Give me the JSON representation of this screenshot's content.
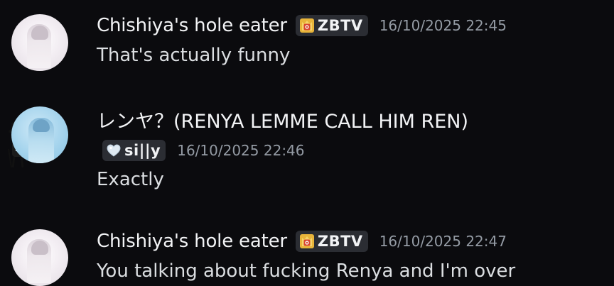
{
  "messages": [
    {
      "username": "Chishiya's hole eater",
      "tag": "ZBTV",
      "tag_icon": "crown-shield-icon",
      "timestamp": "16/10/2025 22:45",
      "content": "That's actually funny",
      "avatar": "pale-portrait"
    },
    {
      "username": "レンヤ？(RENYA LEMME CALL HIM REN)",
      "tag": "si||y",
      "tag_icon": "heart-icon",
      "timestamp": "16/10/2025 22:46",
      "content": "Exactly",
      "avatar": "blue-portrait",
      "decoration": "monopoly-man-icon"
    },
    {
      "username": "Chishiya's hole eater",
      "tag": "ZBTV",
      "tag_icon": "crown-shield-icon",
      "timestamp": "16/10/2025 22:47",
      "content": "You talking about fucking Renya and I'm over",
      "avatar": "pale-portrait"
    }
  ],
  "colors": {
    "background": "#0b0b0e",
    "username": "#f2f3f5",
    "message_text": "#dbdee1",
    "timestamp": "#949ba4",
    "tag_background": "#2b2d33",
    "tag_icon_gold": "#e8b43a",
    "tag_icon_red": "#d8462f"
  }
}
